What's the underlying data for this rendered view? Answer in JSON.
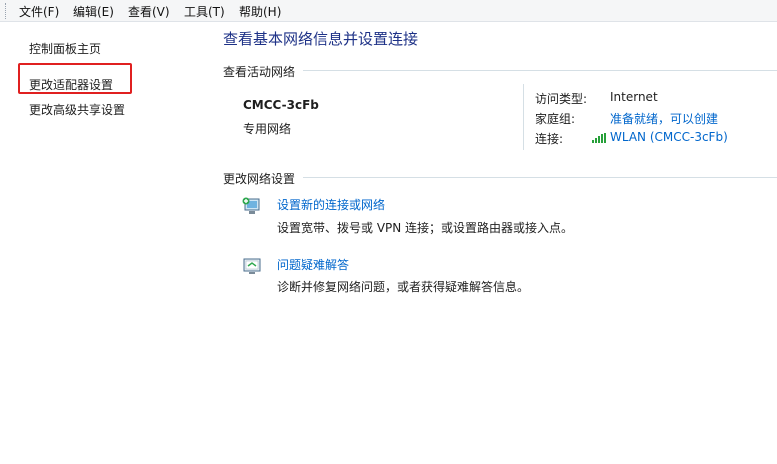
{
  "menu": {
    "items": [
      "文件(F)",
      "编辑(E)",
      "查看(V)",
      "工具(T)",
      "帮助(H)"
    ]
  },
  "sidebar": {
    "items": [
      "控制面板主页",
      "更改适配器设置",
      "更改高级共享设置"
    ],
    "highlighted": "更改适配器设置",
    "highlight_color": "#e02020"
  },
  "main": {
    "title": "查看基本网络信息并设置连接",
    "active_section_label": "查看活动网络",
    "network": {
      "name": "CMCC-3cFb",
      "type": "专用网络",
      "access_type_label": "访问类型:",
      "access_type_value": "Internet",
      "homegroup_label": "家庭组:",
      "homegroup_value": "准备就绪，可以创建",
      "connection_label": "连接:",
      "connection_value": "WLAN (CMCC-3cFb)",
      "connection_icon": "wifi-signal-icon"
    },
    "change_section_label": "更改网络设置",
    "tasks": [
      {
        "icon": "new-connection-icon",
        "title": "设置新的连接或网络",
        "description": "设置宽带、拨号或 VPN 连接；或设置路由器或接入点。"
      },
      {
        "icon": "troubleshoot-icon",
        "title": "问题疑难解答",
        "description": "诊断并修复网络问题，或者获得疑难解答信息。"
      }
    ]
  },
  "colors": {
    "title": "#1e3287",
    "link": "#0066cc",
    "divider": "#d5dfe5"
  }
}
